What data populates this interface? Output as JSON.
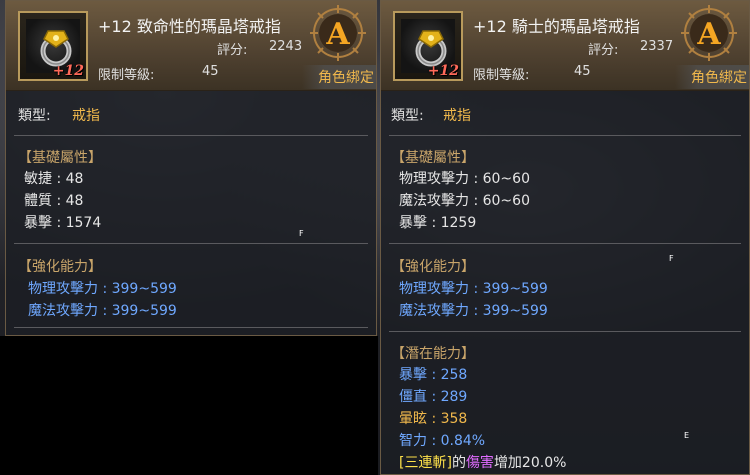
{
  "left_tooltip": {
    "item_name": "+12 致命性的瑪晶塔戒指",
    "enhance_badge": "+12",
    "score_label": "評分:",
    "score_value": "2243",
    "level_label": "限制等級:",
    "level_value": "45",
    "grade": "A",
    "binding": "角色綁定",
    "type_label": "類型:",
    "type_value": "戒指",
    "base_section": "【基礎屬性】",
    "base_stats": [
      "敏捷 : 48",
      "體質 : 48",
      "暴擊 : 1574"
    ],
    "enhance_section": "【強化能力】",
    "enhance_stats": [
      "物理攻擊力 : 399~599",
      "魔法攻擊力 : 399~599"
    ],
    "marker": "F"
  },
  "right_tooltip": {
    "item_name": "+12 騎士的瑪晶塔戒指",
    "enhance_badge": "+12",
    "score_label": "評分:",
    "score_value": "2337",
    "level_label": "限制等級:",
    "level_value": "45",
    "grade": "A",
    "binding": "角色綁定",
    "type_label": "類型:",
    "type_value": "戒指",
    "base_section": "【基礎屬性】",
    "base_stats": [
      "物理攻擊力 : 60~60",
      "魔法攻擊力 : 60~60",
      "暴擊 : 1259"
    ],
    "enhance_section": "【強化能力】",
    "enhance_stats": [
      "物理攻擊力 : 399~599",
      "魔法攻擊力 : 399~599"
    ],
    "latent_section": "【潛在能力】",
    "latent_stats": [
      "暴擊 : 258",
      "僵直 : 289",
      "暈眩 : 358",
      "智力 : 0.84%"
    ],
    "skill_line": {
      "skill": "[三連斬]",
      "of": "的",
      "target": "傷害",
      "effect": "增加20.0%"
    },
    "marker_f": "F",
    "marker_e": "E"
  },
  "colors": {
    "section_title": "#c9a56a",
    "blue_stat": "#6fa8ff",
    "orange_stat": "#f0b84c",
    "binding": "#f0b84c",
    "plus_badge": "#ff6a5a",
    "grade_letter": "#f5a623"
  }
}
